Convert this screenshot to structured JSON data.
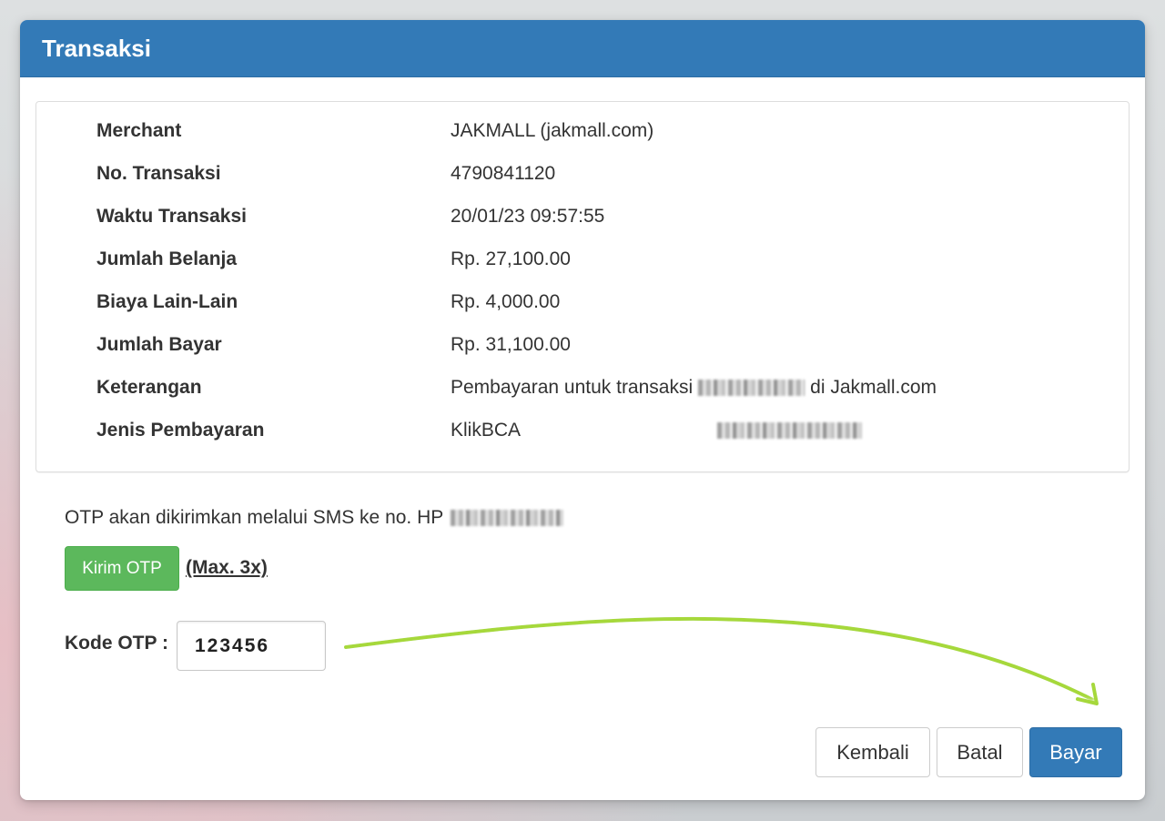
{
  "window": {
    "title": "Transaksi"
  },
  "details": [
    {
      "label": "Merchant",
      "value": "JAKMALL (jakmall.com)"
    },
    {
      "label": "No. Transaksi",
      "value": "4790841120"
    },
    {
      "label": "Waktu Transaksi",
      "value": "20/01/23 09:57:55"
    },
    {
      "label": "Jumlah Belanja",
      "value": "Rp. 27,100.00"
    },
    {
      "label": "Biaya Lain-Lain",
      "value": "Rp. 4,000.00"
    },
    {
      "label": "Jumlah Bayar",
      "value": "Rp. 31,100.00"
    },
    {
      "label": "Keterangan",
      "value_prefix": "Pembayaran untuk transaksi",
      "value_suffix": "di Jakmall.com"
    },
    {
      "label": "Jenis Pembayaran",
      "value": "KlikBCA"
    }
  ],
  "otp": {
    "notice": "OTP akan dikirimkan melalui SMS ke no. HP",
    "send_button": "Kirim OTP",
    "max_note": "(Max. 3x)",
    "code_label": "Kode OTP :",
    "code_value": "123456"
  },
  "actions": {
    "back": "Kembali",
    "cancel": "Batal",
    "pay": "Bayar"
  },
  "colors": {
    "header": "#337ab7",
    "success": "#5cb85c",
    "arrow": "#a6d83a"
  }
}
